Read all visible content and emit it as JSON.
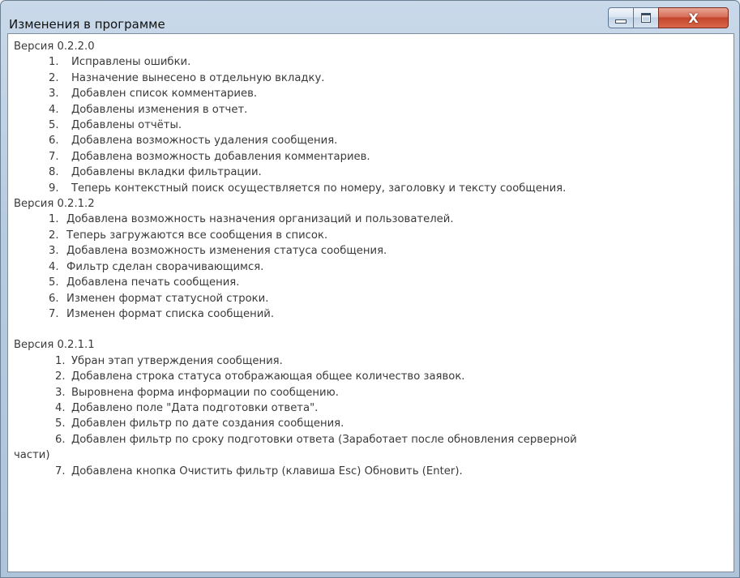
{
  "window": {
    "title": "Изменения в программе",
    "controls": {
      "minimize": "",
      "maximize": "",
      "close": "X"
    }
  },
  "changelog": [
    {
      "version": "Версия 0.2.2.0",
      "items": [
        {
          "num": "1.",
          "text": "Исправлены ошибки."
        },
        {
          "num": "2.",
          "text": "Назначение вынесено в отдельную вкладку."
        },
        {
          "num": "3.",
          "text": "Добавлен список комментариев."
        },
        {
          "num": "4.",
          "text": "Добавлены изменения в отчет."
        },
        {
          "num": "5.",
          "text": "Добавлены отчёты."
        },
        {
          "num": "6.",
          "text": "Добавлена возможность удаления сообщения."
        },
        {
          "num": "7.",
          "text": "Добавлена возможность добавления комментариев."
        },
        {
          "num": "8.",
          "text": "Добавлены вкладки фильтрации."
        },
        {
          "num": "9.",
          "text": "Теперь контекстный поиск осуществляется по номеру, заголовку и тексту сообщения."
        }
      ]
    },
    {
      "version": "Версия 0.2.1.2",
      "items": [
        {
          "num": "1.",
          "text": "Добавлена возможность назначения организаций и пользователей."
        },
        {
          "num": "2.",
          "text": "Теперь загружаются все сообщения в список."
        },
        {
          "num": "3.",
          "text": "Добавлена возможность изменения статуса сообщения."
        },
        {
          "num": "4.",
          "text": "Фильтр сделан сворачивающимся."
        },
        {
          "num": "5.",
          "text": "Добавлена печать сообщения."
        },
        {
          "num": "6.",
          "text": "Изменен формат статусной строки."
        },
        {
          "num": "7.",
          "text": "Изменен формат списка сообщений."
        }
      ]
    },
    {
      "version": "Версия 0.2.1.1",
      "items": [
        {
          "num": "1.",
          "text": "Убран этап утверждения сообщения."
        },
        {
          "num": "2.",
          "text": "Добавлена строка статуса отображающая общее количество заявок."
        },
        {
          "num": "3.",
          "text": "Выровнена форма информации по сообщению."
        },
        {
          "num": "4.",
          "text": "Добавлено поле \"Дата подготовки ответа\"."
        },
        {
          "num": "5.",
          "text": "Добавлен фильтр по дате создания сообщения."
        },
        {
          "num": "6.",
          "text": "Добавлен фильтр по сроку подготовки ответа (Заработает после обновления серверной",
          "continuation": "части)"
        },
        {
          "num": "7.",
          "text": "Добавлена кнопка Очистить фильтр (клавиша Esc) Обновить (Enter)."
        }
      ]
    }
  ]
}
